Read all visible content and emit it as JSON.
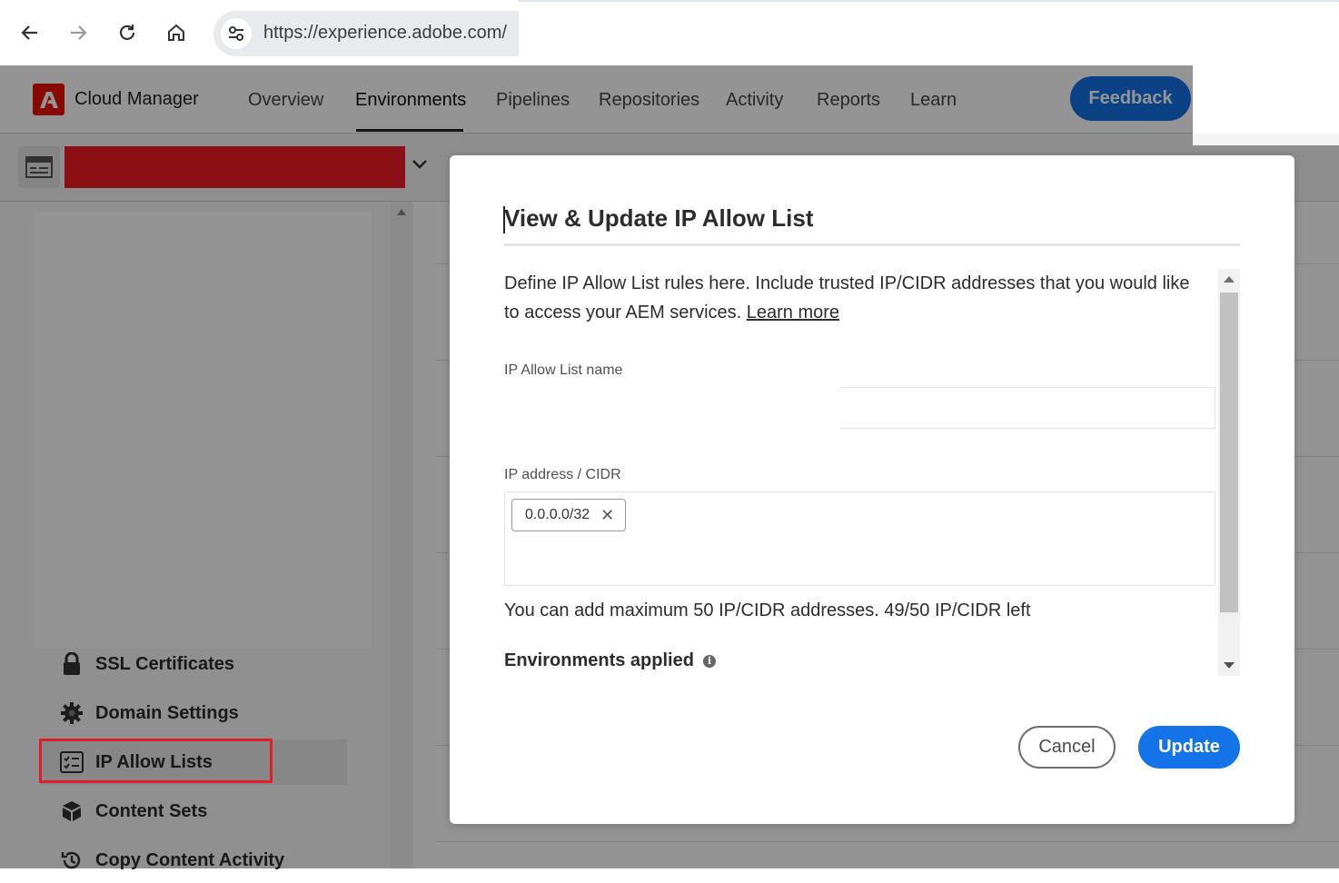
{
  "browser": {
    "url": "https://experience.adobe.com/",
    "back_icon": "arrow-left-icon",
    "forward_icon": "arrow-right-icon",
    "reload_icon": "reload-icon",
    "home_icon": "home-icon",
    "site_info_icon": "tune-icon"
  },
  "app": {
    "name": "Cloud Manager",
    "nav": [
      "Overview",
      "Environments",
      "Pipelines",
      "Repositories",
      "Activity",
      "Reports",
      "Learn"
    ],
    "active_nav": "Environments",
    "feedback_label": "Feedback",
    "accent": "#1473e6"
  },
  "sidebar": {
    "items": [
      {
        "label": "SSL Certificates",
        "icon": "lock-icon"
      },
      {
        "label": "Domain Settings",
        "icon": "gear-icon"
      },
      {
        "label": "IP Allow Lists",
        "icon": "checklist-icon",
        "selected": true
      },
      {
        "label": "Content Sets",
        "icon": "boxes-icon"
      },
      {
        "label": "Copy Content Activity",
        "icon": "history-icon"
      }
    ]
  },
  "dialog": {
    "title": "View & Update IP Allow List",
    "description": "Define IP Allow List rules here. Include trusted IP/CIDR addresses that you would like to access your AEM services.",
    "learn_more": "Learn more",
    "name_label": "IP Allow List name",
    "name_value": "",
    "ip_label": "IP address / CIDR",
    "ip_tags": [
      "0.0.0.0/32"
    ],
    "limit_text": "You can add maximum 50 IP/CIDR addresses. 49/50 IP/CIDR left",
    "environments_label": "Environments applied",
    "cancel_label": "Cancel",
    "update_label": "Update"
  }
}
